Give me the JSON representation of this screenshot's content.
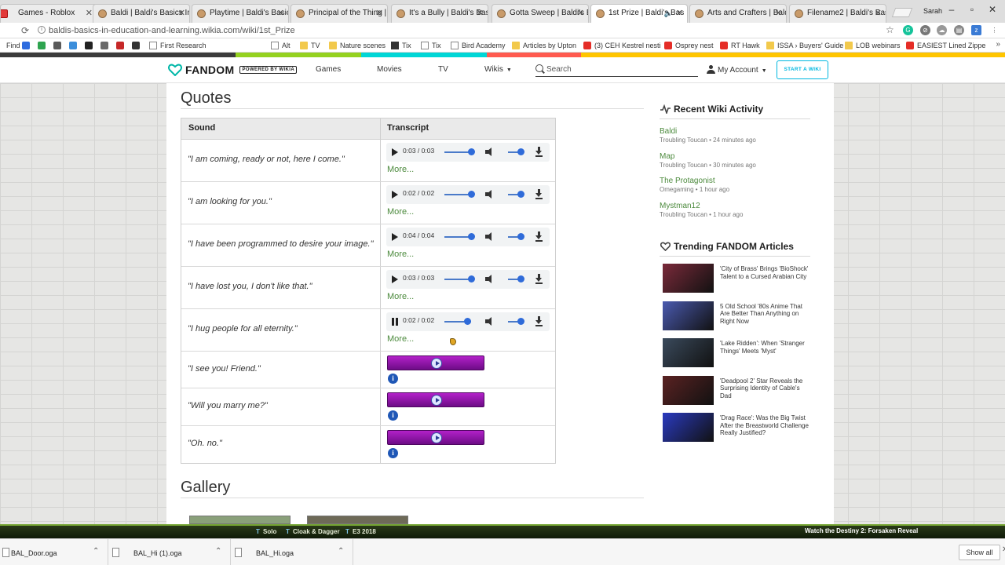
{
  "browser": {
    "tabs": [
      {
        "title": "Games - Roblox",
        "icon": "roblox-favicon"
      },
      {
        "title": "Baldi | Baldi's Basics In E",
        "icon": "baldi-favicon"
      },
      {
        "title": "Playtime | Baldi's Basics",
        "icon": "baldi-favicon"
      },
      {
        "title": "Principal of the Thing | B",
        "icon": "baldi-favicon"
      },
      {
        "title": "It's a Bully | Baldi's Basi",
        "icon": "baldi-favicon"
      },
      {
        "title": "Gotta Sweep | Baldi's Ba",
        "icon": "baldi-favicon"
      },
      {
        "title": "1st Prize | Baldi's Bas",
        "icon": "baldi-favicon",
        "active": true,
        "audio": true
      },
      {
        "title": "Arts and Crafters | Baldi",
        "icon": "baldi-favicon"
      },
      {
        "title": "Filename2 | Baldi's Basic",
        "icon": "baldi-favicon"
      }
    ],
    "profile_name": "Sarah",
    "url": "baldis-basics-in-education-and-learning.wikia.com/wiki/1st_Prize",
    "bookmarks": [
      {
        "label": "Find"
      },
      {
        "label": "First Research"
      },
      {
        "label": "Alt"
      },
      {
        "label": "TV"
      },
      {
        "label": "Nature scenes"
      },
      {
        "label": "Tix"
      },
      {
        "label": "Tix"
      },
      {
        "label": "Bird Academy"
      },
      {
        "label": "Articles by Upton"
      },
      {
        "label": "(3) CEH Kestrel nesti"
      },
      {
        "label": "Osprey nest"
      },
      {
        "label": "RT Hawk"
      },
      {
        "label": "ISSA › Buyers' Guide"
      },
      {
        "label": "LOB webinars"
      },
      {
        "label": "EASIEST Lined Zippe"
      }
    ]
  },
  "fandom_nav": {
    "logo_text": "FANDOM",
    "powered_by": "POWERED BY WIKIA",
    "links": [
      "Games",
      "Movies",
      "TV",
      "Wikis"
    ],
    "search_placeholder": "Search",
    "account_label": "My Account",
    "start_wiki": "START A WIKI"
  },
  "quotes": {
    "heading": "Quotes",
    "col_sound": "Sound",
    "col_transcript": "Transcript",
    "rows": [
      {
        "quote": "\"I am coming, ready or not, here I come.\"",
        "type": "audio",
        "time": "0:03 / 0:03",
        "progress": 1.0,
        "state": "paused",
        "more": "More..."
      },
      {
        "quote": "\"I am looking for you.\"",
        "type": "audio",
        "time": "0:02 / 0:02",
        "progress": 1.0,
        "state": "paused",
        "more": "More..."
      },
      {
        "quote": "\"I have been programmed to desire your image.\"",
        "type": "audio",
        "time": "0:04 / 0:04",
        "progress": 1.0,
        "state": "paused",
        "more": "More..."
      },
      {
        "quote": "\"I have lost you, I don't like that.\"",
        "type": "audio",
        "time": "0:03 / 0:03",
        "progress": 1.0,
        "state": "paused",
        "more": "More..."
      },
      {
        "quote": "\"I hug people for all eternity.\"",
        "type": "audio",
        "time": "0:02 / 0:02",
        "progress": 0.85,
        "state": "playing",
        "more": "More..."
      },
      {
        "quote": "\"I see you! Friend.\"",
        "type": "flash"
      },
      {
        "quote": "\"Will you marry me?\"",
        "type": "flash"
      },
      {
        "quote": "\"Oh. no.\"",
        "type": "flash"
      }
    ]
  },
  "gallery": {
    "heading": "Gallery"
  },
  "rail": {
    "recent_title": "Recent Wiki Activity",
    "recent": [
      {
        "page": "Baldi",
        "meta": "Troubling Toucan • 24 minutes ago"
      },
      {
        "page": "Map",
        "meta": "Troubling Toucan • 30 minutes ago"
      },
      {
        "page": "The Protagonist",
        "meta": "Omegaming • 1 hour ago"
      },
      {
        "page": "Mystman12",
        "meta": "Troubling Toucan • 1 hour ago"
      }
    ],
    "trending_title": "Trending FANDOM Articles",
    "trending": [
      {
        "text": "'City of Brass' Brings 'BioShock' Talent to a Cursed Arabian City",
        "color": "#7a2a3a"
      },
      {
        "text": "5 Old School '80s Anime That Are Better Than Anything on Right Now",
        "color": "#4a5ab0"
      },
      {
        "text": "'Lake Ridden': When 'Stranger Things' Meets 'Myst'",
        "color": "#3a4a5c"
      },
      {
        "text": "'Deadpool 2' Star Reveals the Surprising Identity of Cable's Dad",
        "color": "#5a2222"
      },
      {
        "text": "'Drag Race': Was the Big Twist After the Breastworld Challenge Really Justified?",
        "color": "#2a3ac0"
      }
    ]
  },
  "promo_bar": {
    "tabs": [
      "Solo",
      "Cloak & Dagger",
      "E3 2018"
    ],
    "right_text": "Watch the Destiny 2: Forsaken Reveal"
  },
  "downloads": {
    "items": [
      "BAL_Door.oga",
      "BAL_Hi (1).oga",
      "BAL_Hi.oga"
    ],
    "show_all": "Show all"
  }
}
